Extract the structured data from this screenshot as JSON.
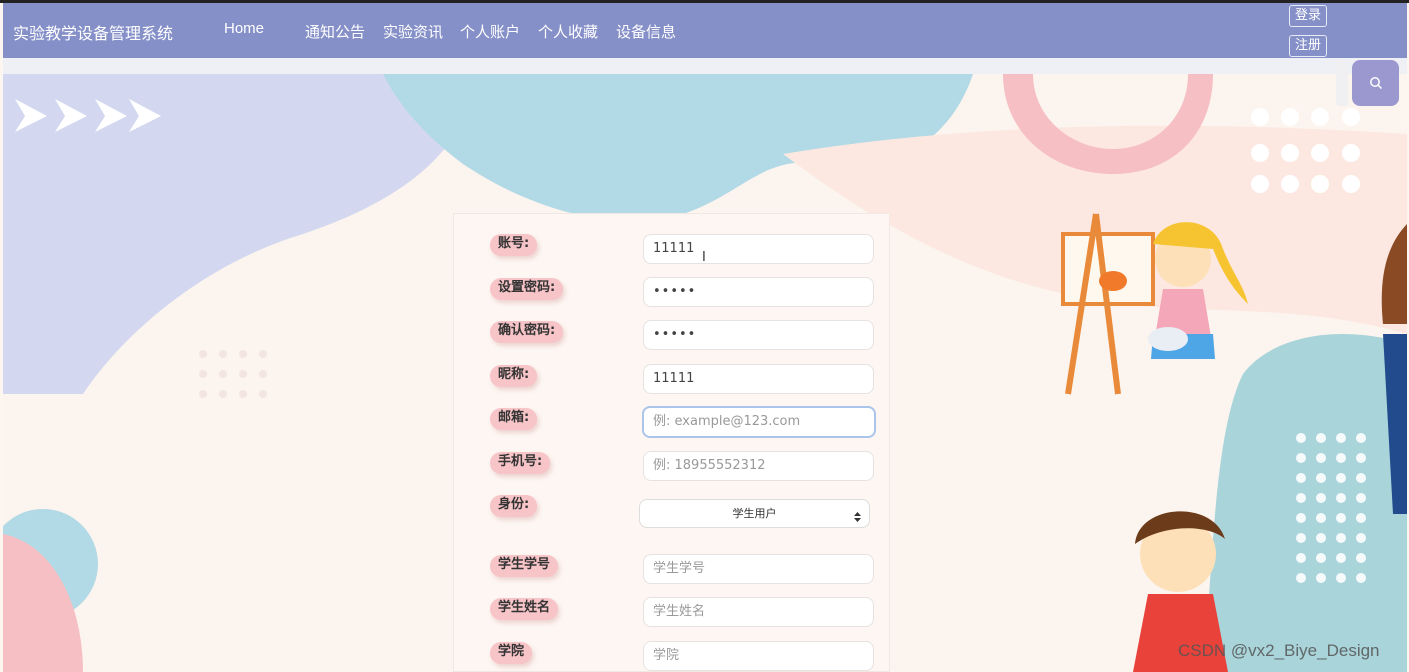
{
  "brand": "实验教学设备管理系统",
  "nav": [
    "Home",
    "通知公告",
    "实验资讯",
    "个人账户",
    "个人收藏",
    "设备信息"
  ],
  "auth": {
    "login": "登录",
    "register": "注册"
  },
  "search_icon": "search-icon",
  "form": {
    "account": {
      "label": "账号:",
      "value": "11111"
    },
    "password": {
      "label": "设置密码:",
      "value": "•••••"
    },
    "confirm": {
      "label": "确认密码:",
      "value": "•••••"
    },
    "nickname": {
      "label": "昵称:",
      "value": "11111"
    },
    "email": {
      "label": "邮箱:",
      "placeholder": "例: example@123.com"
    },
    "phone": {
      "label": "手机号:",
      "placeholder": "例: 18955552312"
    },
    "identity": {
      "label": "身份:",
      "selected": "学生用户"
    },
    "student_id": {
      "label": "学生学号",
      "placeholder": "学生学号"
    },
    "student_name": {
      "label": "学生姓名",
      "placeholder": "学生姓名"
    },
    "college": {
      "label": "学院",
      "placeholder": "学院"
    }
  },
  "watermark": "CSDN @vx2_Biye_Design",
  "colors": {
    "navbar": "#8690c8",
    "label_pill": "#f7c4c8",
    "search_button": "#9b97cf"
  }
}
